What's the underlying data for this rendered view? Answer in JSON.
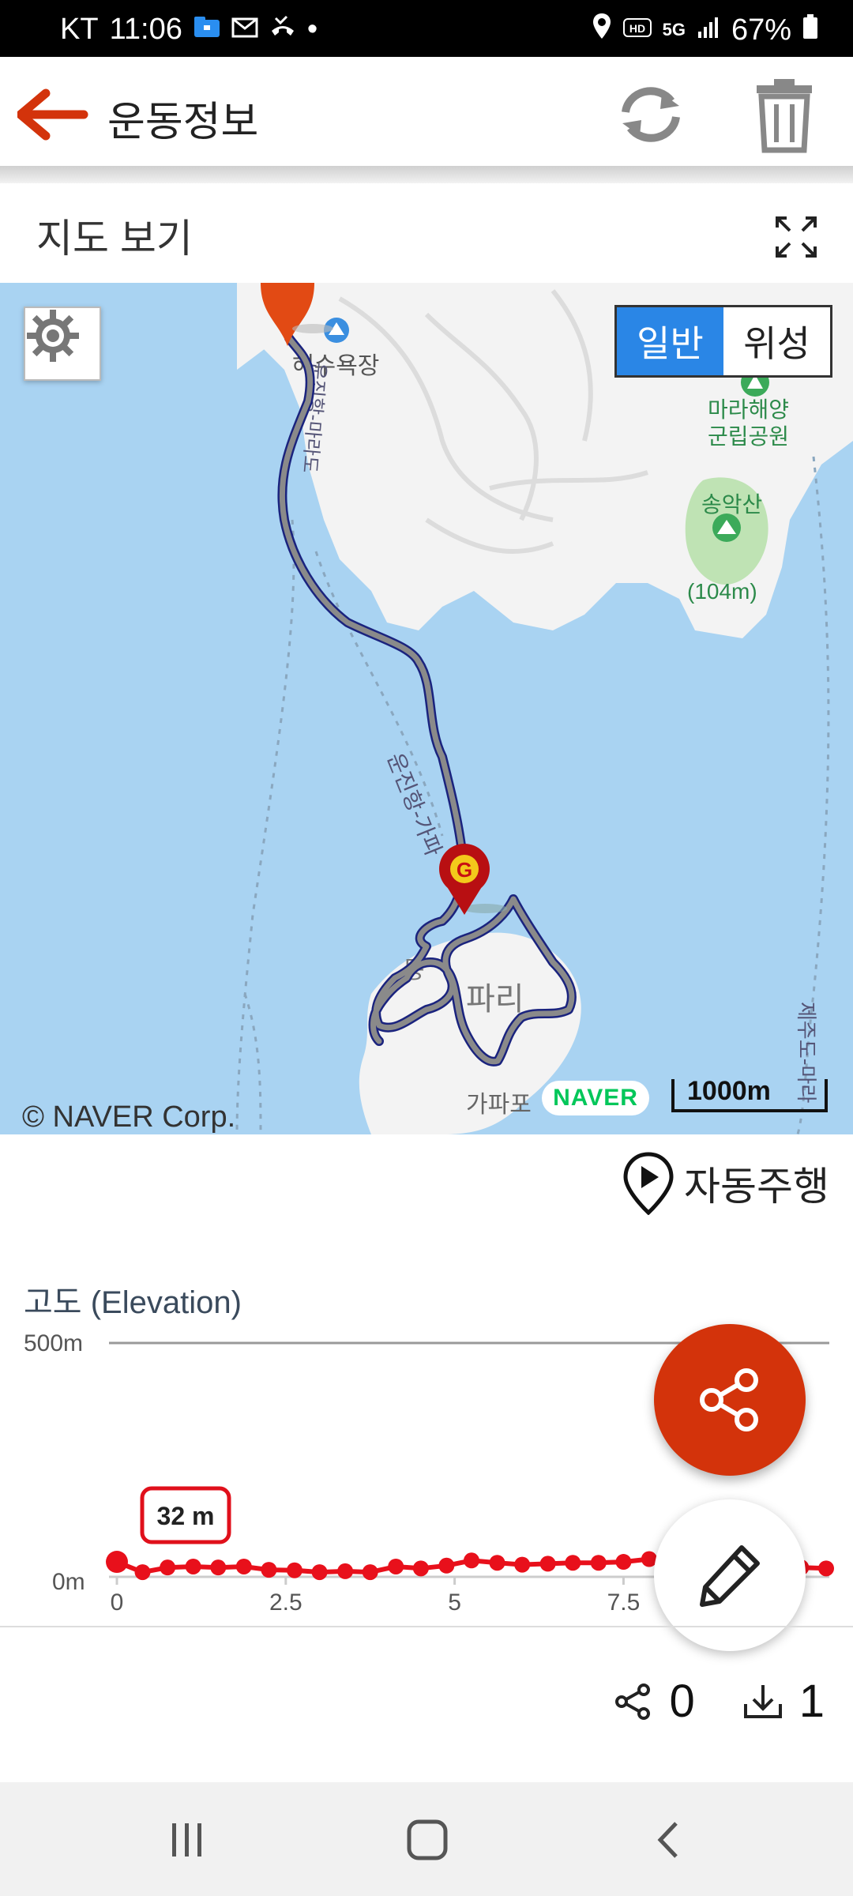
{
  "status_bar": {
    "carrier": "KT",
    "time": "11:06",
    "dot": "•",
    "network": "5G",
    "battery": "67%"
  },
  "app_bar": {
    "title": "운동정보"
  },
  "map_section": {
    "title": "지도 보기",
    "map_type_options": [
      "일반",
      "위성"
    ],
    "selected_map_type": "일반",
    "labels": {
      "beach": "해수욕장",
      "park": "마라해양\n군립공원",
      "mountain": "송악산",
      "mountain_height": "(104m)",
      "ferry_route": "운진항-가파",
      "island": "파리",
      "port": "가파포",
      "dong": "동",
      "road_right": "제주도-마라",
      "road_left": "운진항-마라도"
    },
    "copyright": "© NAVER Corp.",
    "provider": "NAVER",
    "scale": "1000m"
  },
  "autodrive_label": "자동주행",
  "elevation": {
    "label": "고도 (Elevation)",
    "tooltip": "32 m"
  },
  "chart_data": {
    "type": "line",
    "title": "고도 (Elevation)",
    "yticks": [
      "500m",
      "0m"
    ],
    "xticks": [
      "0",
      "2.5",
      "5",
      "7.5"
    ],
    "ylim": [
      0,
      500
    ],
    "xlim": [
      0,
      10.5
    ],
    "x": [
      0,
      0.38,
      0.75,
      1.13,
      1.5,
      1.88,
      2.25,
      2.63,
      3.0,
      3.38,
      3.75,
      4.13,
      4.5,
      4.88,
      5.25,
      5.63,
      6.0,
      6.38,
      6.75,
      7.13,
      7.5,
      7.88,
      8.25,
      8.63,
      9.0,
      9.38,
      9.75,
      10.13,
      10.5
    ],
    "y": [
      32,
      10,
      20,
      22,
      20,
      22,
      15,
      14,
      10,
      12,
      10,
      22,
      18,
      24,
      35,
      30,
      26,
      28,
      30,
      30,
      32,
      38,
      40,
      28,
      26,
      24,
      22,
      20,
      18
    ],
    "grid": true
  },
  "stats": {
    "share_count": "0",
    "download_count": "1"
  },
  "colors": {
    "accent": "#d3330b",
    "route": "#8a8a8a",
    "elevation": "#e8101b",
    "map_water": "#a9d3f2",
    "map_land": "#f3f3f3",
    "map_type_selected": "#2a86e6"
  }
}
